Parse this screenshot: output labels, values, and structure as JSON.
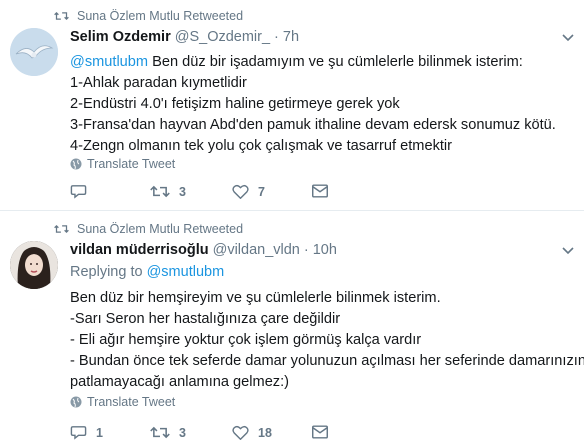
{
  "tweets": [
    {
      "retweeted_by": "Suna Özlem Mutlu Retweeted",
      "name": "Selim Ozdemir",
      "handle": "@S_Ozdemir_",
      "separator": "·",
      "time": "7h",
      "mention": "@smutlubm",
      "lines": [
        " Ben düz bir işadamıyım ve şu cümlelerle bilinmek isterim:",
        "1-Ahlak paradan kıymetlidir",
        "2-Endüstri 4.0'ı fetişizm haline getirmeye gerek yok",
        "3-Fransa'dan hayvan Abd'den pamuk ithaline devam edersk sonumuz kötü.",
        "4-Zengn olmanın tek yolu çok çalışmak ve tasarruf etmektir"
      ],
      "translate": "Translate Tweet",
      "reply_count": "",
      "retweet_count": "3",
      "like_count": "7",
      "avatar_icon": "seagull-avatar"
    },
    {
      "retweeted_by": "Suna Özlem Mutlu Retweeted",
      "name": "vildan müderrisoğlu",
      "handle": "@vildan_vldn",
      "separator": "·",
      "time": "10h",
      "replying_label": "Replying to",
      "replying_to": "@smutlubm",
      "lines": [
        "Ben düz bir hemşireyim ve şu cümlelerle bilinmek isterim.",
        "-Sarı Seron her hastalığınıza çare değildir",
        "- Eli ağır hemşire yoktur çok işlem görmüş kalça vardır",
        "- Bundan önce tek seferde damar yolunuzun açılması her seferinde damarınızın",
        "patlamayacağı anlamına gelmez:)"
      ],
      "translate": "Translate Tweet",
      "reply_count": "1",
      "retweet_count": "3",
      "like_count": "18",
      "avatar_icon": "woman-portrait-avatar"
    }
  ],
  "colors": {
    "text": "#14171a",
    "muted": "#657786",
    "link": "#1b95e0",
    "divider": "#e6ecf0"
  }
}
